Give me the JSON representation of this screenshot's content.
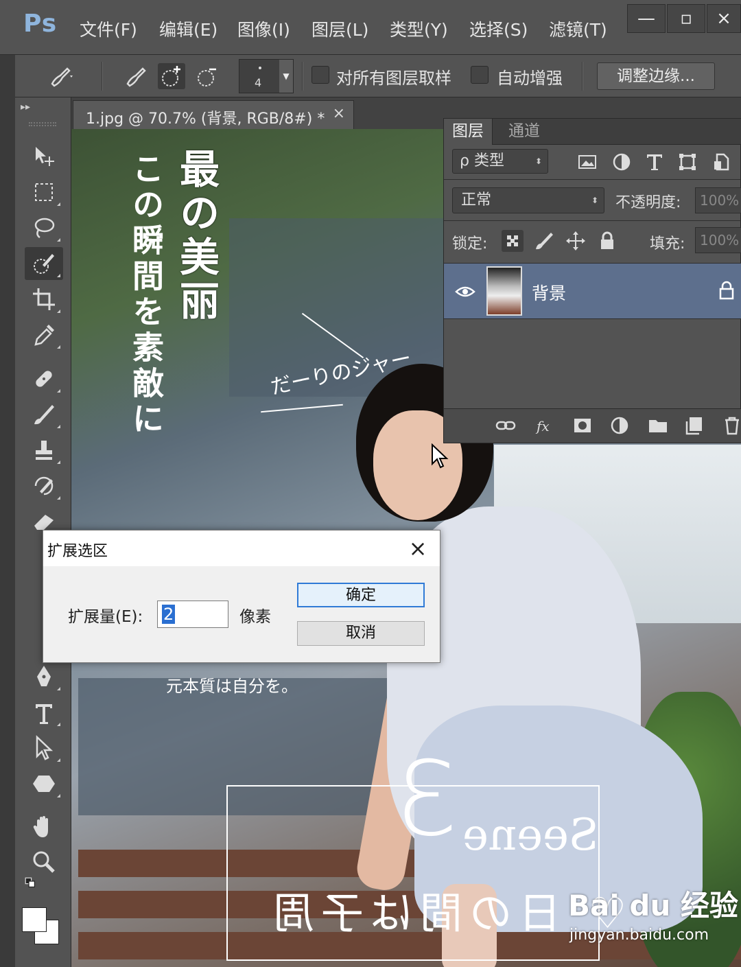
{
  "app": {
    "logo": "Ps"
  },
  "menu": [
    "文件(F)",
    "编辑(E)",
    "图像(I)",
    "图层(L)",
    "类型(Y)",
    "选择(S)",
    "滤镜(T)"
  ],
  "window_controls": {
    "minimize": "—",
    "restore": "▫",
    "close": "×"
  },
  "options_bar": {
    "brush_size": "4",
    "sample_all_layers": {
      "label": "对所有图层取样",
      "checked": false
    },
    "auto_enhance": {
      "label": "自动增强",
      "checked": false
    },
    "refine_edge_button": "调整边缘..."
  },
  "document_tab": {
    "title": "1.jpg @ 70.7% (背景, RGB/8#) *",
    "close": "×"
  },
  "tools": [
    "move-tool",
    "marquee-tool",
    "lasso-tool",
    "quick-selection-tool",
    "crop-tool",
    "eyedropper-tool",
    "healing-brush-tool",
    "brush-tool",
    "clone-stamp-tool",
    "history-brush-tool",
    "eraser-tool",
    "pen-tool",
    "type-tool",
    "path-selection-tool",
    "shape-tool",
    "hand-tool",
    "zoom-tool"
  ],
  "canvas_text": {
    "vertical_main": "最の美丽",
    "vertical_side": "この瞬間を素敵に",
    "annotation": "だーりのジャー",
    "caption_line1": "元本質は自分を。",
    "caption_line2": "Seene",
    "scene_number": "3",
    "scene_subtitle": "♡ 日の間は子周",
    "watermark_logo": "Bai du 经验",
    "watermark_url": "jingyan.baidu.com"
  },
  "layers_panel": {
    "tabs": [
      "图层",
      "通道"
    ],
    "filter_label": "ρ 类型",
    "blend_mode": "正常",
    "opacity_label": "不透明度:",
    "opacity_value": "100%",
    "lock_label": "锁定:",
    "fill_label": "填充:",
    "fill_value": "100%",
    "layers": [
      {
        "name": "背景",
        "visible": true,
        "locked": true
      }
    ]
  },
  "dialog": {
    "title": "扩展选区",
    "close": "×",
    "field_label": "扩展量(E):",
    "field_value": "2",
    "unit": "像素",
    "ok_button": "确定",
    "cancel_button": "取消"
  },
  "colors": {
    "ui_dark": "#535353",
    "layer_selected": "#5d6f8d",
    "dialog_focus": "#2f7ad6"
  }
}
